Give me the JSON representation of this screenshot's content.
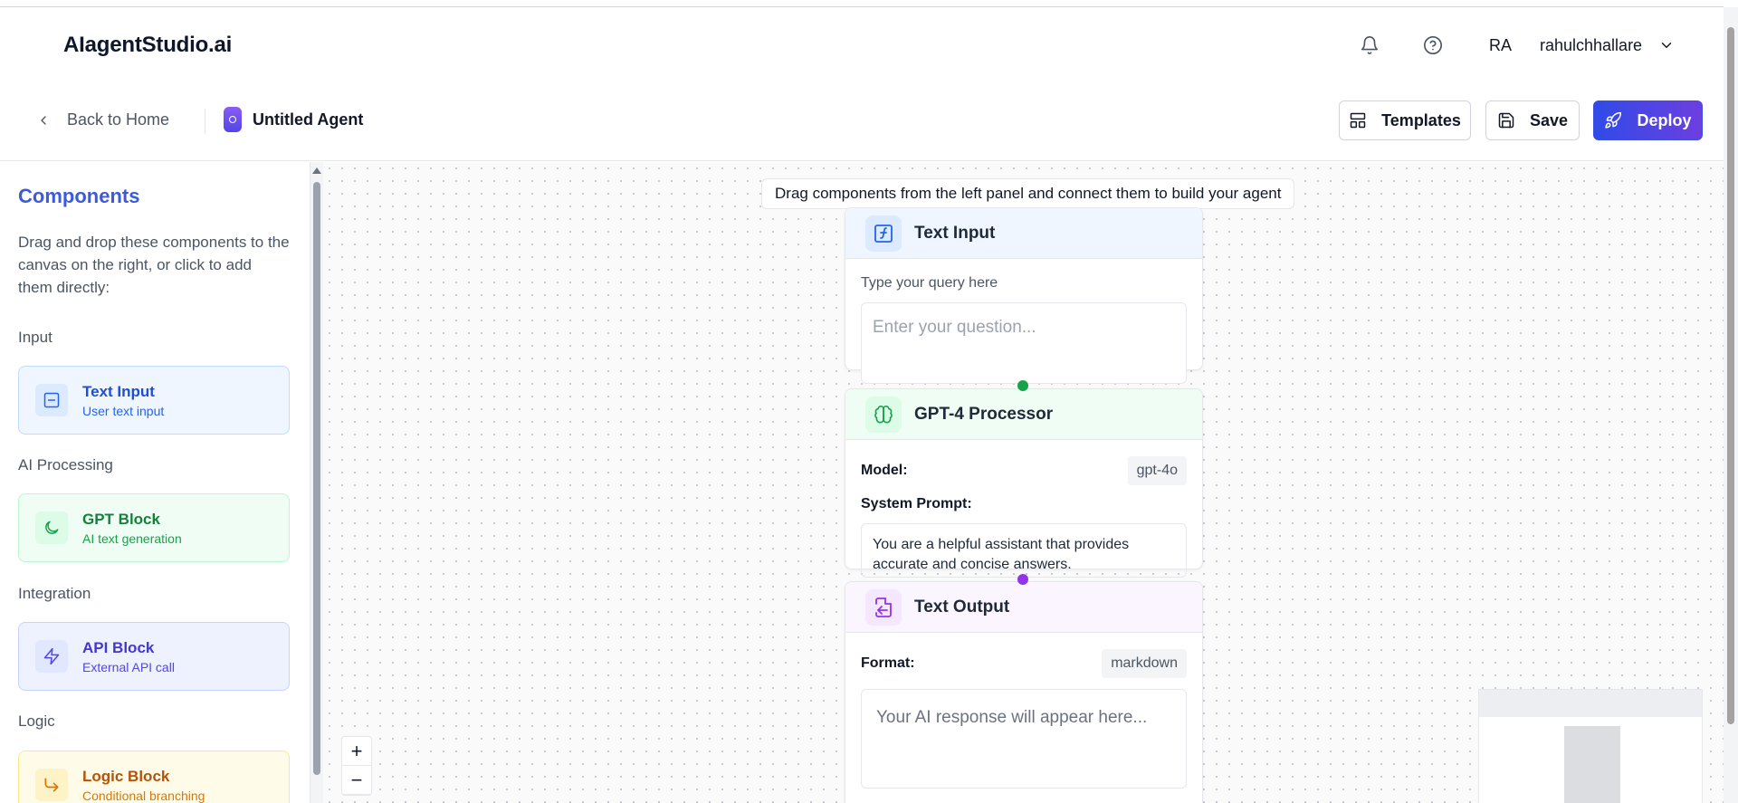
{
  "header": {
    "brand": "AIagentStudio.ai",
    "notifications_icon": "bell-icon",
    "help_icon": "help-circle-icon",
    "user_initials": "RA",
    "username": "rahulchhallare"
  },
  "toolbar": {
    "back_label": "Back to Home",
    "agent_name": "Untitled Agent",
    "templates_label": "Templates",
    "save_label": "Save",
    "deploy_label": "Deploy"
  },
  "sidebar": {
    "title": "Components",
    "description": "Drag and drop these components to the canvas on the right, or click to add them directly:",
    "sections": [
      {
        "label": "Input",
        "item": {
          "name": "Text Input",
          "sub": "User text input",
          "icon": "minus-square-icon"
        }
      },
      {
        "label": "AI Processing",
        "item": {
          "name": "GPT Block",
          "sub": "AI text generation",
          "icon": "moon-icon"
        }
      },
      {
        "label": "Integration",
        "item": {
          "name": "API Block",
          "sub": "External API call",
          "icon": "zap-icon"
        }
      },
      {
        "label": "Logic",
        "item": {
          "name": "Logic Block",
          "sub": "Conditional branching",
          "icon": "corner-down-right-icon"
        }
      }
    ]
  },
  "canvas": {
    "hint": "Drag components from the left panel and connect them to build your agent",
    "text_input_node": {
      "title": "Text Input",
      "label": "Type your query here",
      "placeholder": "Enter your question..."
    },
    "gpt_node": {
      "title": "GPT-4 Processor",
      "model_label": "Model:",
      "model_value": "gpt-4o",
      "system_label": "System Prompt:",
      "system_prompt": "You are a helpful assistant that provides accurate and concise answers."
    },
    "output_node": {
      "title": "Text Output",
      "format_label": "Format:",
      "format_value": "markdown",
      "placeholder": "Your AI response will appear here..."
    },
    "zoom_in": "+",
    "zoom_out": "−"
  },
  "colors": {
    "accent": "#3b5bdb",
    "deploy_start": "#2f4be8",
    "deploy_end": "#6d3ee0",
    "input_tint": "#eff6ff",
    "gpt_tint": "#f0fdf4",
    "output_tint": "#faf5ff",
    "logic_tint": "#fefce8"
  }
}
